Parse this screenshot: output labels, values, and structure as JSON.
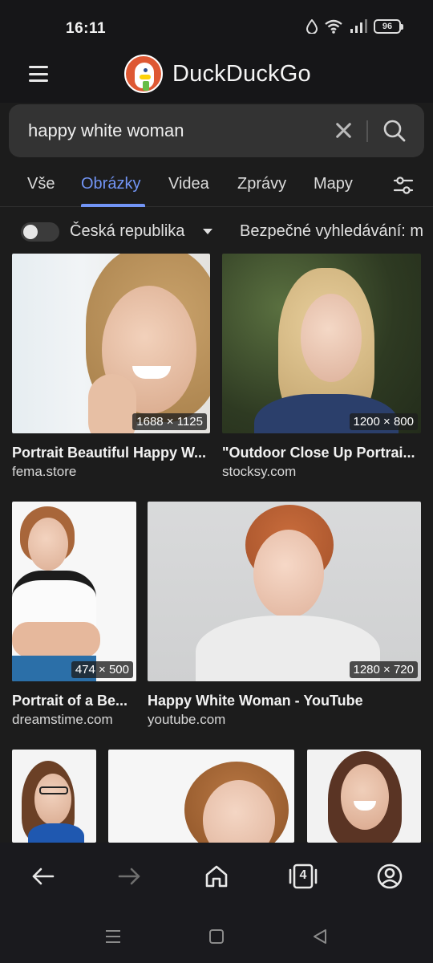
{
  "status": {
    "time": "16:11",
    "battery": "96"
  },
  "header": {
    "brand": "DuckDuckGo"
  },
  "search": {
    "query": "happy white woman"
  },
  "tabs": [
    {
      "label": "Vše"
    },
    {
      "label": "Obrázky"
    },
    {
      "label": "Videa"
    },
    {
      "label": "Zprávy"
    },
    {
      "label": "Mapy"
    }
  ],
  "filters": {
    "region": "Česká republika",
    "safe_search": "Bezpečné vyhledávání: m"
  },
  "results": [
    {
      "dims": "1688 × 1125",
      "title": "Portrait Beautiful Happy W...",
      "source": "fema.store"
    },
    {
      "dims": "1200 × 800",
      "title": "\"Outdoor Close Up Portrai...",
      "source": "stocksy.com"
    },
    {
      "dims": "474 × 500",
      "title": "Portrait of a Be...",
      "source": "dreamstime.com"
    },
    {
      "dims": "1280 × 720",
      "title": "Happy White Woman - YouTube",
      "source": "youtube.com"
    }
  ],
  "bottom_nav": {
    "tab_count": "4"
  },
  "colors": {
    "accent": "#7295f6",
    "brand": "#de5833",
    "background": "#1c1c1c"
  }
}
